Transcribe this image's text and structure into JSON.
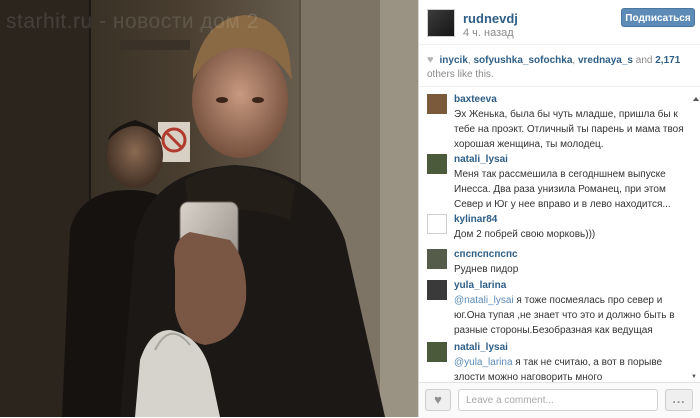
{
  "photo": {
    "watermark": "starhit.ru - новости дом 2"
  },
  "post": {
    "username": "rudnevdj",
    "time": "4 ч. назад",
    "follow_label": "Подписаться"
  },
  "likes": {
    "names": [
      "inycik",
      "sofyushka_sofochka",
      "vrednaya_s"
    ],
    "and_text": "and",
    "count": "2,171",
    "suffix": "others like this."
  },
  "comments": [
    {
      "user": "baxteeva",
      "text": "Эх Женька, была бы чуть младше, пришла бы к тебе на проэкт. Отличный ты парень и мама твоя хорошая женщина, ты молодец.",
      "avatar_color": "#7a5a3a"
    },
    {
      "user": "natali_lysai",
      "text": "Меня так рассмешила в сегодншнем выпуске Инесса. Два раза унизила Романец, при этом Север и Юг у нее вправо и в лево находится...",
      "avatar_color": "#4a5a3a"
    },
    {
      "user": "kylinar84",
      "text": "Дом 2 побрей свою морковь)))",
      "avatar_color": "#ffffff"
    },
    {
      "user": "спспспспспс",
      "text": "Руднев пидор",
      "avatar_color": "#555c4a"
    },
    {
      "user": "yula_larina",
      "mention": "@natali_lysai",
      "text": "я тоже посмеялась про север и юг.Она тупая ,не знает что это и должно быть в разные стороны.Безобразная как ведущая",
      "avatar_color": "#3a3a3a"
    },
    {
      "user": "natali_lysai",
      "mention": "@yula_larina",
      "text": "я так не считаю, а вот в порыве злости можно наговорить много",
      "avatar_color": "#4a5a3a"
    }
  ],
  "footer": {
    "comment_placeholder": "Leave a comment...",
    "more_label": "..."
  },
  "icons": {
    "like": "heart-icon",
    "more": "ellipsis-icon",
    "scroll_up": "scroll-up-arrow-icon",
    "scroll_down": "scroll-down-arrow-icon"
  },
  "colors": {
    "link_blue": "#2e5e86",
    "follow_button": "#5b8bb6"
  }
}
